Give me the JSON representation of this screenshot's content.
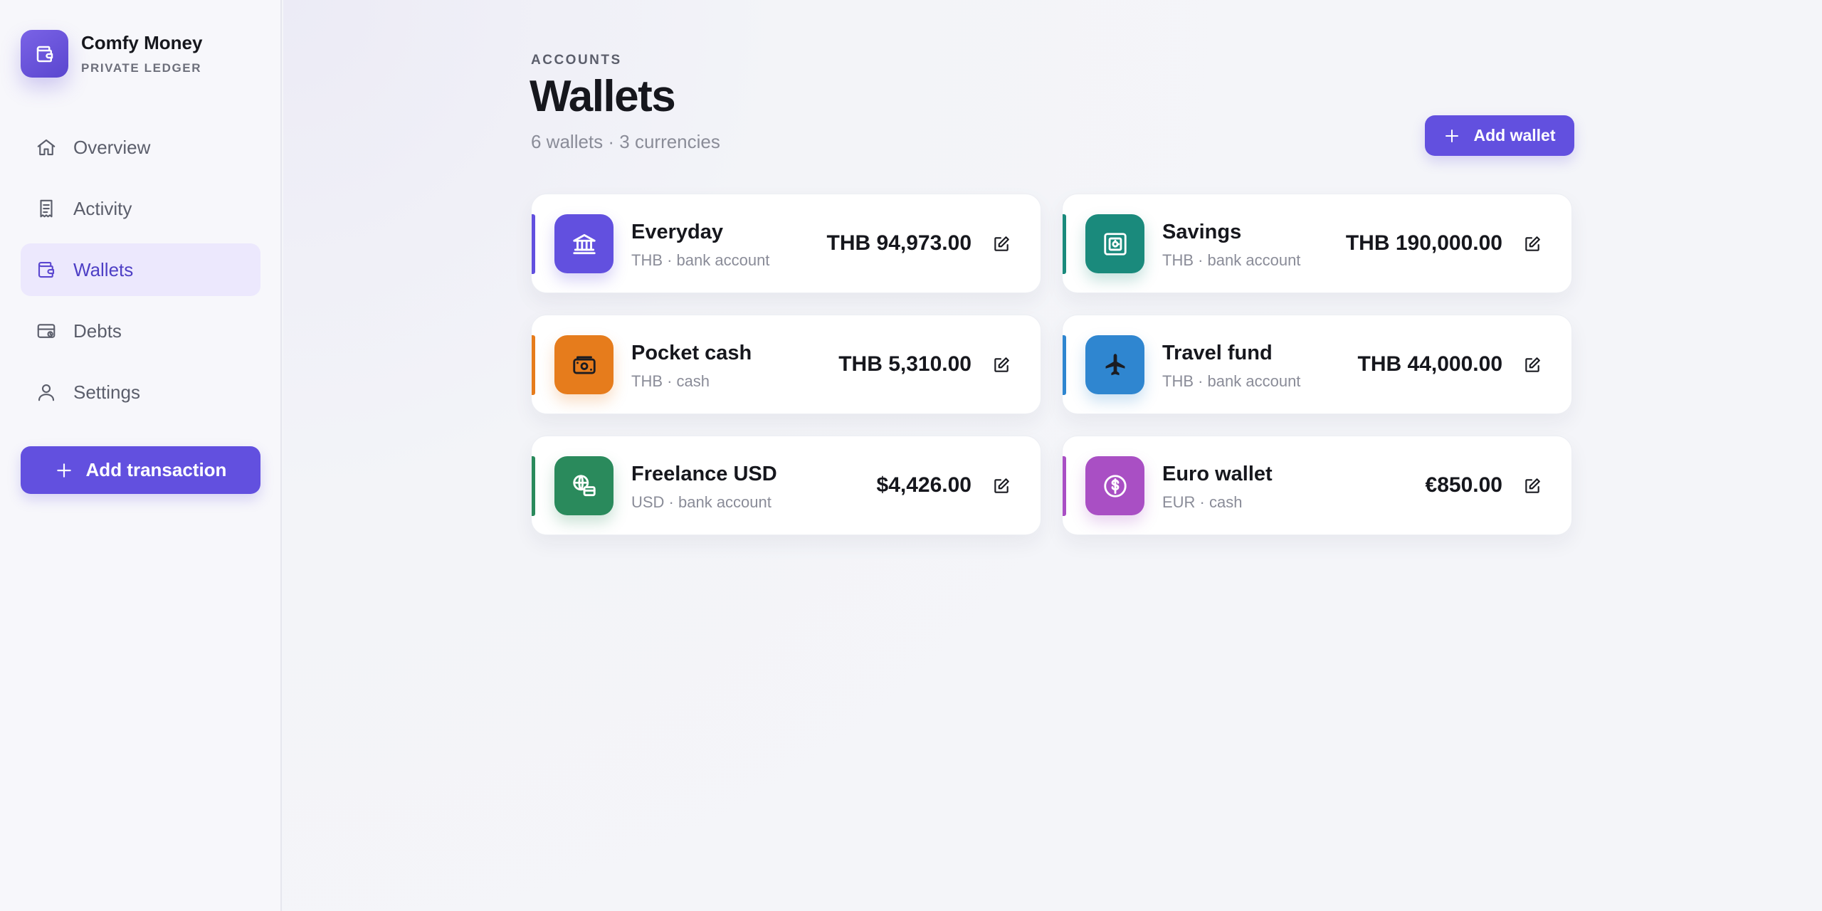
{
  "brand": {
    "name": "Comfy Money",
    "subtitle": "PRIVATE LEDGER",
    "icon": "wallet-icon"
  },
  "nav": [
    {
      "label": "Overview",
      "icon": "home-icon",
      "active": false
    },
    {
      "label": "Activity",
      "icon": "receipt-icon",
      "active": false
    },
    {
      "label": "Wallets",
      "icon": "wallet-icon",
      "active": true
    },
    {
      "label": "Debts",
      "icon": "card-clock-icon",
      "active": false
    },
    {
      "label": "Settings",
      "icon": "user-icon",
      "active": false
    }
  ],
  "add_transaction_label": "Add transaction",
  "header": {
    "eyebrow": "ACCOUNTS",
    "title": "Wallets",
    "subtitle": "6 wallets · 3 currencies",
    "add_wallet_label": "Add wallet"
  },
  "wallets": [
    {
      "name": "Everyday",
      "meta": "THB · bank account",
      "balance": "THB 94,973.00",
      "icon": "bank-icon",
      "color": "#6250df"
    },
    {
      "name": "Savings",
      "meta": "THB · bank account",
      "balance": "THB 190,000.00",
      "icon": "safe-icon",
      "color": "#1a8a7c"
    },
    {
      "name": "Pocket cash",
      "meta": "THB · cash",
      "balance": "THB 5,310.00",
      "icon": "cash-icon",
      "color": "#e67c1c"
    },
    {
      "name": "Travel fund",
      "meta": "THB · bank account",
      "balance": "THB 44,000.00",
      "icon": "plane-icon",
      "color": "#2f86d0"
    },
    {
      "name": "Freelance USD",
      "meta": "USD · bank account",
      "balance": "$4,426.00",
      "icon": "globe-card-icon",
      "color": "#2a8a5c"
    },
    {
      "name": "Euro wallet",
      "meta": "EUR · cash",
      "balance": "€850.00",
      "icon": "coin-icon",
      "color": "#a94fc4"
    }
  ]
}
